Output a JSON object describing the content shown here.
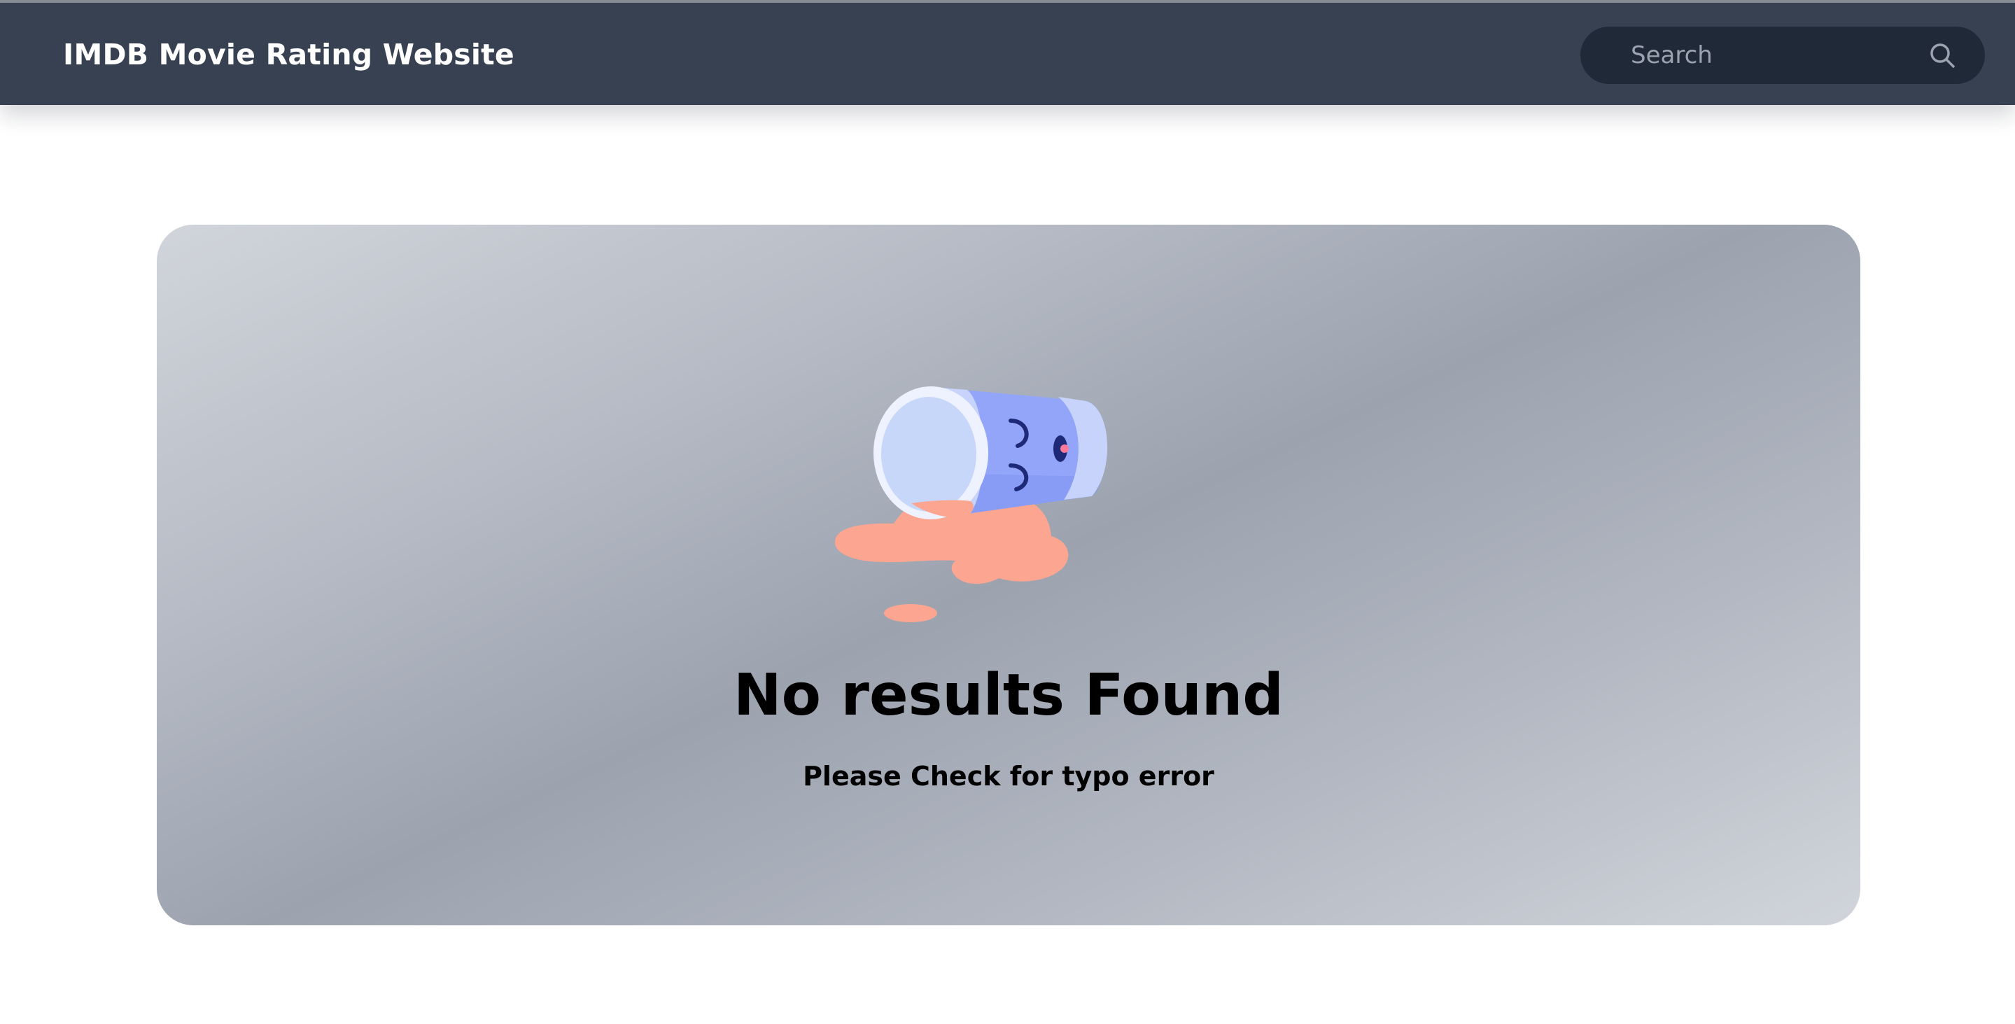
{
  "header": {
    "title": "IMDB Movie Rating Website"
  },
  "search": {
    "placeholder": "Search",
    "icon": "search-icon"
  },
  "empty_state": {
    "title": "No results Found",
    "message": "Please Check for typo error",
    "illustration": "spilled-cup-illustration"
  },
  "colors": {
    "navbar": "#374151",
    "search_background": "#1f2937",
    "card_gradient": [
      "#d1d5db",
      "#9ca3af"
    ],
    "spill": "#fca591",
    "cup": "#93a5f8"
  }
}
